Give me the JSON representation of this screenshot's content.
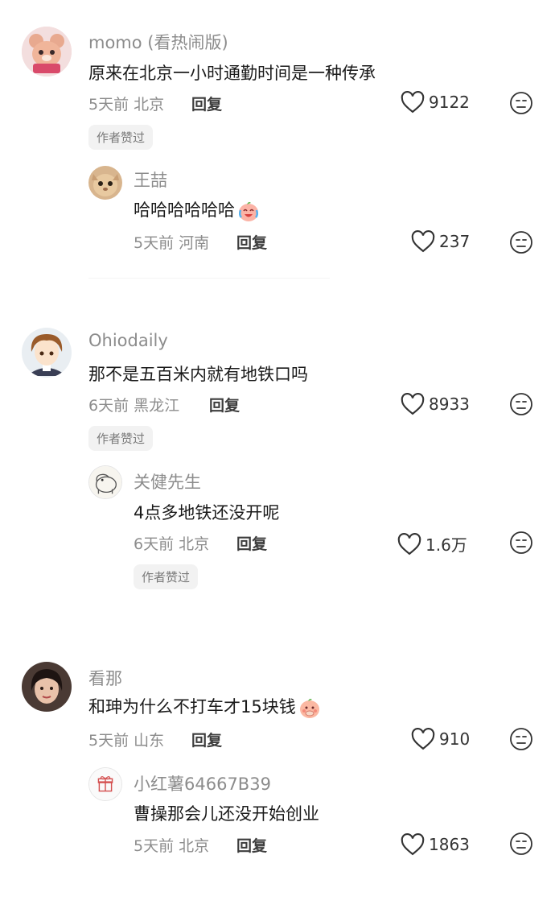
{
  "threads": [
    {
      "name": "momo (看热闹版)",
      "text": "原来在北京一小时通勤时间是一种传承",
      "time": "5天前",
      "location": "北京",
      "reply_label": "回复",
      "likes": "9122",
      "badge": "作者赞过",
      "reply": {
        "name": "王喆",
        "text": "哈哈哈哈哈哈",
        "emoji": "crying-laughing-emoji",
        "time": "5天前",
        "location": "河南",
        "reply_label": "回复",
        "likes": "237"
      }
    },
    {
      "name": "Ohiodaily",
      "text": "那不是五百米内就有地铁口吗",
      "time": "6天前",
      "location": "黑龙江",
      "reply_label": "回复",
      "likes": "8933",
      "badge": "作者赞过",
      "reply": {
        "name": "关健先生",
        "text": "4点多地铁还没开呢",
        "time": "6天前",
        "location": "北京",
        "reply_label": "回复",
        "likes": "1.6万",
        "badge": "作者赞过"
      }
    },
    {
      "name": "看那",
      "text": "和珅为什么不打车才15块钱",
      "emoji": "shy-peach-emoji",
      "time": "5天前",
      "location": "山东",
      "reply_label": "回复",
      "likes": "910",
      "reply": {
        "name": "小红薯64667B39",
        "text": "曹操那会儿还没开始创业",
        "time": "5天前",
        "location": "北京",
        "reply_label": "回复",
        "likes": "1863"
      }
    }
  ],
  "colors": {
    "secondary_text": "#8c8c8c",
    "primary_text": "#1a1a1a",
    "badge_bg": "#f2f2f2"
  }
}
